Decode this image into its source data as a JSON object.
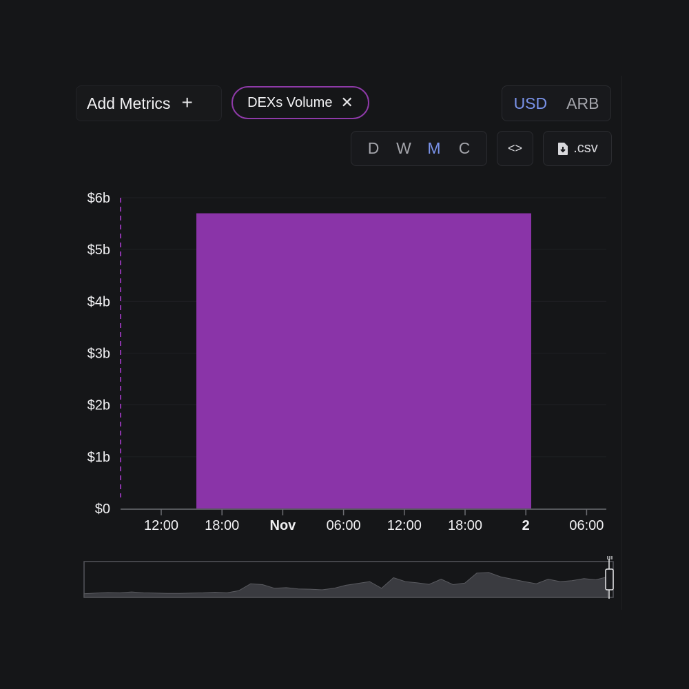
{
  "toolbar": {
    "add_metrics_label": "Add Metrics",
    "add_icon": "plus-icon",
    "metric_chip_label": "DEXs Volume",
    "remove_icon": "close-icon",
    "currency": {
      "active": "USD",
      "inactive": "ARB"
    },
    "periods": [
      "D",
      "W",
      "M",
      "C"
    ],
    "active_period": "M",
    "embed_icon": "code-brackets-icon",
    "csv_label": ".csv",
    "csv_icon": "file-download-icon"
  },
  "colors": {
    "background": "#151618",
    "series": "#8a34a8",
    "chip_border": "#8e3aa8",
    "active_accent": "#7a93ea",
    "navigator_fill": "#3a3b40"
  },
  "chart_data": {
    "type": "bar",
    "title": "",
    "xlabel": "",
    "ylabel": "",
    "y_ticks": [
      "$0",
      "$1b",
      "$2b",
      "$3b",
      "$4b",
      "$5b",
      "$6b"
    ],
    "ylim": [
      0,
      6000000000
    ],
    "x_ticks": [
      {
        "label": "12:00",
        "bold": false
      },
      {
        "label": "18:00",
        "bold": false
      },
      {
        "label": "Nov",
        "bold": true
      },
      {
        "label": "06:00",
        "bold": false
      },
      {
        "label": "12:00",
        "bold": false
      },
      {
        "label": "18:00",
        "bold": false
      },
      {
        "label": "2",
        "bold": true
      },
      {
        "label": "06:00",
        "bold": false
      }
    ],
    "series": [
      {
        "values": [
          5700000000
        ]
      }
    ],
    "grid": true,
    "navigator": {
      "profile": [
        0.12,
        0.14,
        0.16,
        0.15,
        0.18,
        0.15,
        0.14,
        0.13,
        0.13,
        0.14,
        0.15,
        0.17,
        0.15,
        0.22,
        0.45,
        0.42,
        0.3,
        0.32,
        0.28,
        0.27,
        0.25,
        0.3,
        0.4,
        0.46,
        0.52,
        0.3,
        0.65,
        0.52,
        0.48,
        0.43,
        0.6,
        0.42,
        0.47,
        0.8,
        0.82,
        0.68,
        0.6,
        0.52,
        0.45,
        0.6,
        0.52,
        0.55,
        0.62,
        0.58,
        0.68
      ]
    }
  }
}
